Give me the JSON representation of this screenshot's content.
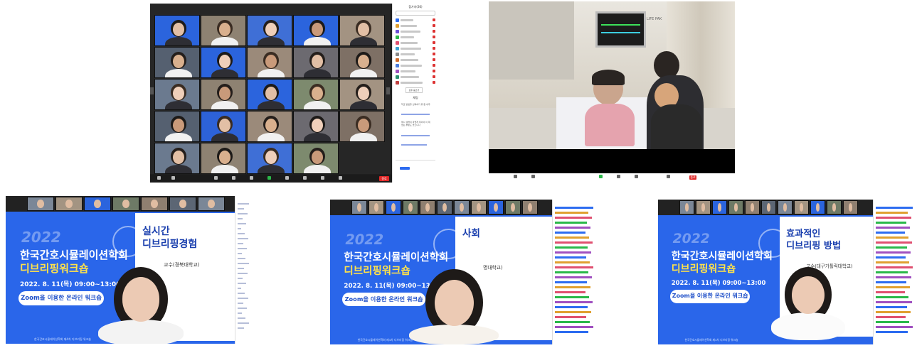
{
  "shot1": {
    "panel_title": "참가자(36)",
    "chat_title": "채팅",
    "chat_messages": [
      "학교 방법을 선택하기 위 원 내주",
      "해시 설명이 마들게 되어서 이 제 없는 부분도 많으니다"
    ],
    "mute_all_label": "모두 음소거",
    "end_label": "종료"
  },
  "shot2": {
    "monitor_label": "LIFE PAK",
    "end_label": "종료"
  },
  "slides": [
    {
      "year": "2022",
      "title_line1": "한국간호시뮬레이션학회",
      "title_line2": "디브리핑워크숍",
      "date": "2022. 8. 11(목) 09:00~13:00",
      "zoom_pill": "Zoom을 이용한 온라인 워크숍",
      "topic_line1": "실시간",
      "topic_line2": "디브리핑경험",
      "org": "교수(경북대학교)",
      "footer": "한국간호시뮬레이션학회 제4차 디브리핑 워크숍"
    },
    {
      "year": "2022",
      "title_line1": "한국간호시뮬레이션학회",
      "title_line2": "디브리핑워크숍",
      "date": "2022. 8. 11(목) 09:00~13:00",
      "zoom_pill": "Zoom을 이용한 온라인 워크숍",
      "topic_line1": "사회",
      "topic_line2": "",
      "org": "명대학교)",
      "footer": "한국간호시뮬레이션학회 제4차 디브리핑 워크숍"
    },
    {
      "year": "2022",
      "title_line1": "한국간호시뮬레이션학회",
      "title_line2": "디브리핑워크숍",
      "date": "2022. 8. 11(목) 09:00~13:00",
      "zoom_pill": "Zoom을 이용한 온라인 워크숍",
      "topic_line1": "효과적인",
      "topic_line2": "디브리핑 방법",
      "org": "교수(대구가톨릭대학교)",
      "footer": "한국간호시뮬레이션학회 제4차 디브리핑 워크숍"
    }
  ],
  "colors": {
    "slide_blue": "#2a66ea",
    "title_yellow": "#ffe24a",
    "end_red": "#e02828",
    "zoom_toolbar": "#1b1b1b"
  }
}
